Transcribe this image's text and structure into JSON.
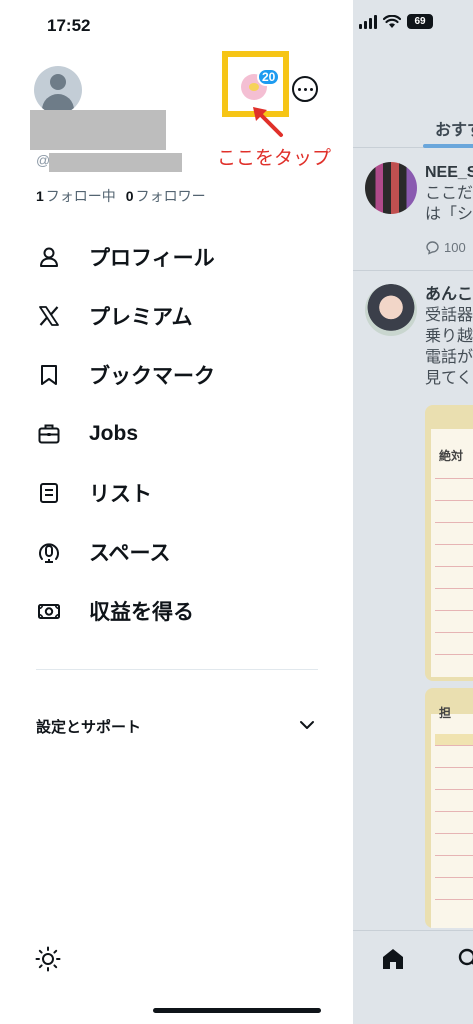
{
  "status_bar": {
    "time": "17:52",
    "battery": "69"
  },
  "drawer": {
    "handle_prefix": "@",
    "following_count": "1",
    "following_label": "フォロー中",
    "followers_count": "0",
    "followers_label": "フォロワー",
    "account_badge_count": "20",
    "annotation": "ここをタップ",
    "menu": [
      {
        "label": "プロフィール",
        "icon": "person-icon"
      },
      {
        "label": "プレミアム",
        "icon": "x-logo-icon"
      },
      {
        "label": "ブックマーク",
        "icon": "bookmark-icon"
      },
      {
        "label": "Jobs",
        "icon": "briefcase-icon"
      },
      {
        "label": "リスト",
        "icon": "list-icon"
      },
      {
        "label": "スペース",
        "icon": "spaces-icon"
      },
      {
        "label": "収益を得る",
        "icon": "money-icon"
      }
    ],
    "settings_label": "設定とサポート"
  },
  "background_feed": {
    "tab_label": "おすす",
    "post1": {
      "name": "NEE_S",
      "line1": "ここだ",
      "line2": "は「シ",
      "replies": "100"
    },
    "post2": {
      "name": "あんこ",
      "line1": "受話器",
      "line2": "乗り越",
      "line3": "電話が",
      "line4": "見てく"
    },
    "card1_title": "絶対",
    "card2_title": "担"
  },
  "colors": {
    "highlight": "#f6c516",
    "annotation": "#e0302a",
    "badge": "#1d9bf0"
  }
}
